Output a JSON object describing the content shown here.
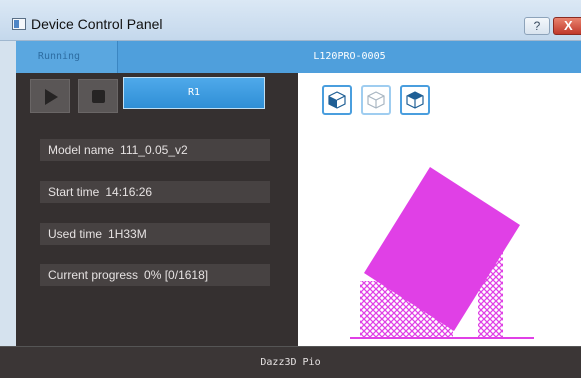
{
  "window": {
    "title": "Device Control Panel",
    "help_label": "?",
    "close_label": "X"
  },
  "status": {
    "state": "Running",
    "device": "L120PRO-0005"
  },
  "controls": {
    "play_icon": "play-icon",
    "stop_icon": "stop-icon",
    "resin_button": "R1"
  },
  "info": {
    "model_label": "Model name",
    "model_value": "111_0.05_v2",
    "start_label": "Start time",
    "start_value": "14:16:26",
    "used_label": "Used time",
    "used_value": "1H33M",
    "progress_label": "Current progress",
    "progress_value": "0% [0/1618]"
  },
  "viewport": {
    "view_buttons": [
      "front-view-icon",
      "wireframe-view-icon",
      "top-view-icon"
    ],
    "model_color": "#e040e6"
  },
  "footer": {
    "brand": "Dazz3D Pio"
  },
  "colors": {
    "accent": "#4f9fdc",
    "panel": "#353030",
    "info_row": "#474242"
  }
}
